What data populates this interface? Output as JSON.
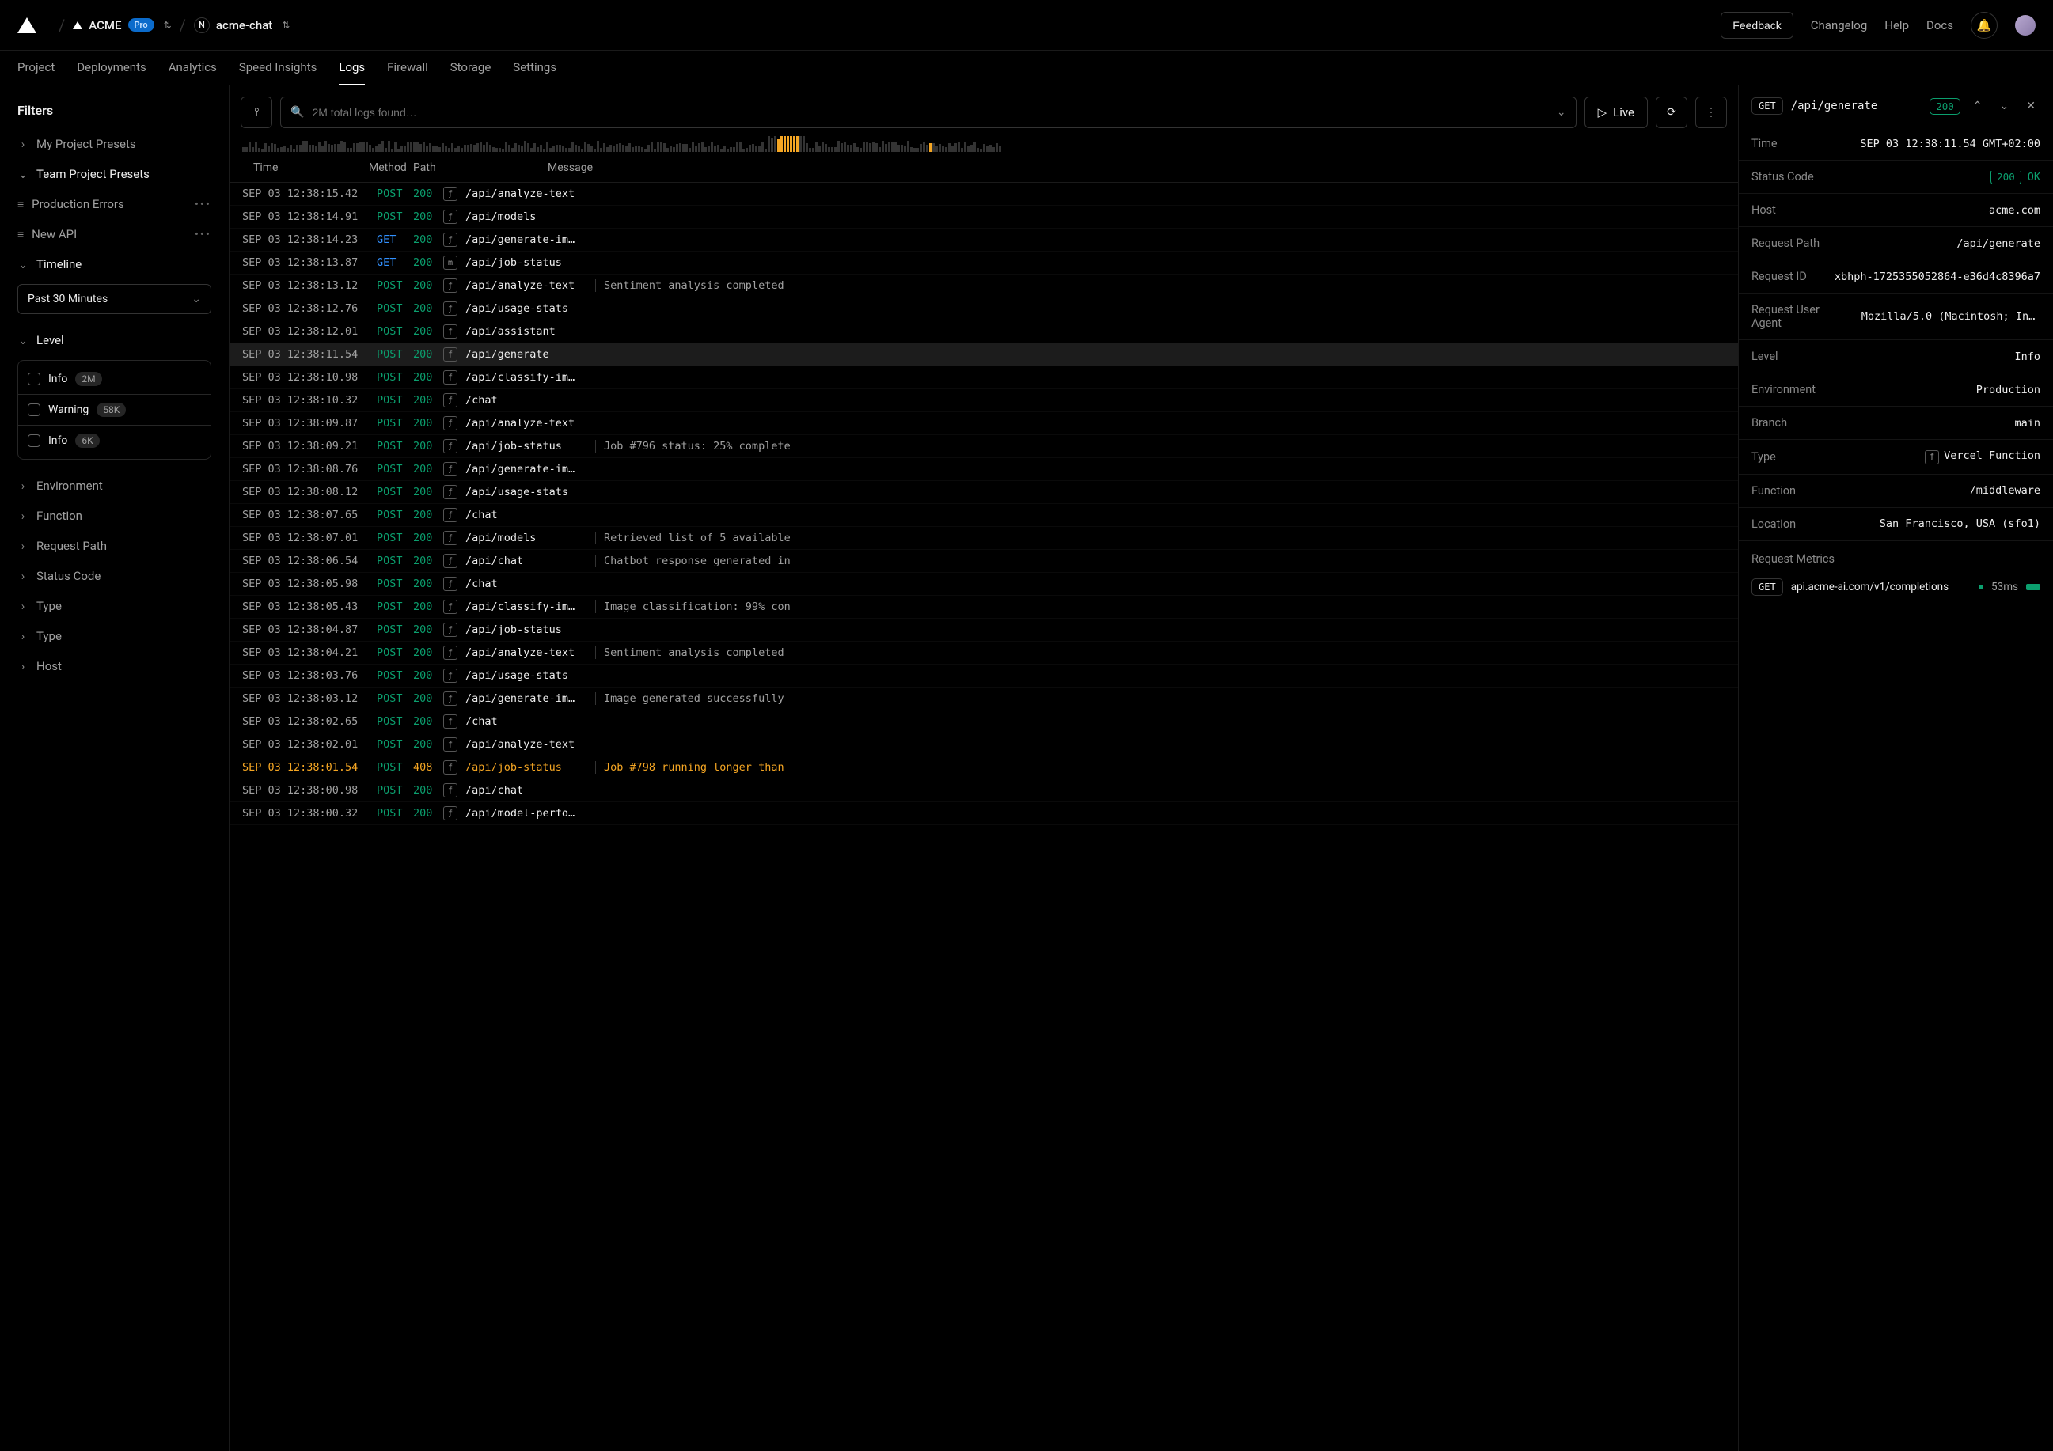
{
  "topbar": {
    "team": "ACME",
    "badge": "Pro",
    "project": "acme-chat",
    "feedback": "Feedback",
    "links": [
      "Changelog",
      "Help",
      "Docs"
    ]
  },
  "tabs": [
    "Project",
    "Deployments",
    "Analytics",
    "Speed Insights",
    "Logs",
    "Firewall",
    "Storage",
    "Settings"
  ],
  "active_tab": "Logs",
  "sidebar": {
    "title": "Filters",
    "my_presets": "My Project Presets",
    "team_presets": "Team Project Presets",
    "presets": [
      {
        "name": "Production Errors"
      },
      {
        "name": "New API"
      }
    ],
    "timeline_label": "Timeline",
    "timeline_value": "Past 30 Minutes",
    "level_label": "Level",
    "levels": [
      {
        "name": "Info",
        "count": "2M"
      },
      {
        "name": "Warning",
        "count": "58K"
      },
      {
        "name": "Info",
        "count": "6K"
      }
    ],
    "filters": [
      "Environment",
      "Function",
      "Request Path",
      "Status Code",
      "Type",
      "Type",
      "Host"
    ]
  },
  "toolbar": {
    "search_placeholder": "2M total logs found…",
    "live": "Live"
  },
  "columns": {
    "time": "Time",
    "method": "Method",
    "path": "Path",
    "message": "Message"
  },
  "logs": [
    {
      "ts": "SEP 03 12:38:15.42",
      "m": "POST",
      "s": "200",
      "icon": "fn",
      "p": "/api/analyze-text",
      "msg": ""
    },
    {
      "ts": "SEP 03 12:38:14.91",
      "m": "POST",
      "s": "200",
      "icon": "fn",
      "p": "/api/models",
      "msg": ""
    },
    {
      "ts": "SEP 03 12:38:14.23",
      "m": "GET",
      "s": "200",
      "icon": "fn",
      "p": "/api/generate-im…",
      "msg": ""
    },
    {
      "ts": "SEP 03 12:38:13.87",
      "m": "GET",
      "s": "200",
      "icon": "m",
      "p": "/api/job-status",
      "msg": ""
    },
    {
      "ts": "SEP 03 12:38:13.12",
      "m": "POST",
      "s": "200",
      "icon": "fn",
      "p": "/api/analyze-text",
      "msg": "Sentiment analysis completed"
    },
    {
      "ts": "SEP 03 12:38:12.76",
      "m": "POST",
      "s": "200",
      "icon": "fn",
      "p": "/api/usage-stats",
      "msg": ""
    },
    {
      "ts": "SEP 03 12:38:12.01",
      "m": "POST",
      "s": "200",
      "icon": "fn",
      "p": "/api/assistant",
      "msg": ""
    },
    {
      "ts": "SEP 03 12:38:11.54",
      "m": "POST",
      "s": "200",
      "icon": "fn",
      "p": "/api/generate",
      "msg": "",
      "selected": true
    },
    {
      "ts": "SEP 03 12:38:10.98",
      "m": "POST",
      "s": "200",
      "icon": "fn",
      "p": "/api/classify-im…",
      "msg": ""
    },
    {
      "ts": "SEP 03 12:38:10.32",
      "m": "POST",
      "s": "200",
      "icon": "fn",
      "p": "/chat",
      "msg": ""
    },
    {
      "ts": "SEP 03 12:38:09.87",
      "m": "POST",
      "s": "200",
      "icon": "fn",
      "p": "/api/analyze-text",
      "msg": ""
    },
    {
      "ts": "SEP 03 12:38:09.21",
      "m": "POST",
      "s": "200",
      "icon": "fn",
      "p": "/api/job-status",
      "msg": "Job #796 status: 25% complete"
    },
    {
      "ts": "SEP 03 12:38:08.76",
      "m": "POST",
      "s": "200",
      "icon": "fn",
      "p": "/api/generate-im…",
      "msg": ""
    },
    {
      "ts": "SEP 03 12:38:08.12",
      "m": "POST",
      "s": "200",
      "icon": "fn",
      "p": "/api/usage-stats",
      "msg": ""
    },
    {
      "ts": "SEP 03 12:38:07.65",
      "m": "POST",
      "s": "200",
      "icon": "fn",
      "p": "/chat",
      "msg": ""
    },
    {
      "ts": "SEP 03 12:38:07.01",
      "m": "POST",
      "s": "200",
      "icon": "fn",
      "p": "/api/models",
      "msg": "Retrieved list of 5 available"
    },
    {
      "ts": "SEP 03 12:38:06.54",
      "m": "POST",
      "s": "200",
      "icon": "fn",
      "p": "/api/chat",
      "msg": "Chatbot response generated in"
    },
    {
      "ts": "SEP 03 12:38:05.98",
      "m": "POST",
      "s": "200",
      "icon": "fn",
      "p": "/chat",
      "msg": ""
    },
    {
      "ts": "SEP 03 12:38:05.43",
      "m": "POST",
      "s": "200",
      "icon": "fn",
      "p": "/api/classify-im…",
      "msg": "Image classification: 99% con"
    },
    {
      "ts": "SEP 03 12:38:04.87",
      "m": "POST",
      "s": "200",
      "icon": "fn",
      "p": "/api/job-status",
      "msg": ""
    },
    {
      "ts": "SEP 03 12:38:04.21",
      "m": "POST",
      "s": "200",
      "icon": "fn",
      "p": "/api/analyze-text",
      "msg": "Sentiment analysis completed"
    },
    {
      "ts": "SEP 03 12:38:03.76",
      "m": "POST",
      "s": "200",
      "icon": "fn",
      "p": "/api/usage-stats",
      "msg": ""
    },
    {
      "ts": "SEP 03 12:38:03.12",
      "m": "POST",
      "s": "200",
      "icon": "fn",
      "p": "/api/generate-im…",
      "msg": "Image generated successfully"
    },
    {
      "ts": "SEP 03 12:38:02.65",
      "m": "POST",
      "s": "200",
      "icon": "fn",
      "p": "/chat",
      "msg": ""
    },
    {
      "ts": "SEP 03 12:38:02.01",
      "m": "POST",
      "s": "200",
      "icon": "fn",
      "p": "/api/analyze-text",
      "msg": ""
    },
    {
      "ts": "SEP 03 12:38:01.54",
      "m": "POST",
      "s": "408",
      "icon": "fn",
      "p": "/api/job-status",
      "msg": "Job #798 running longer than",
      "warn": true
    },
    {
      "ts": "SEP 03 12:38:00.98",
      "m": "POST",
      "s": "200",
      "icon": "fn",
      "p": "/api/chat",
      "msg": ""
    },
    {
      "ts": "SEP 03 12:38:00.32",
      "m": "POST",
      "s": "200",
      "icon": "fn",
      "p": "/api/model-perfo…",
      "msg": ""
    }
  ],
  "detail": {
    "method": "GET",
    "path": "/api/generate",
    "status": "200",
    "kv": [
      {
        "k": "Time",
        "v": "SEP 03 12:38:11.54 GMT+02:00"
      },
      {
        "k": "Status Code",
        "v": "200",
        "ok": "OK",
        "badge": true
      },
      {
        "k": "Host",
        "v": "acme.com"
      },
      {
        "k": "Request Path",
        "v": "/api/generate"
      },
      {
        "k": "Request ID",
        "v": "xbhph-1725355052864-e36d4c8396a7"
      },
      {
        "k": "Request User Agent",
        "v": "Mozilla/5.0 (Macintosh; Int…"
      },
      {
        "k": "Level",
        "v": "Info"
      },
      {
        "k": "Environment",
        "v": "Production"
      },
      {
        "k": "Branch",
        "v": "main"
      },
      {
        "k": "Type",
        "v": "Vercel Function",
        "icon": "fn"
      },
      {
        "k": "Function",
        "v": "/middleware"
      },
      {
        "k": "Location",
        "v": "San Francisco, USA (sfo1)"
      }
    ],
    "metrics_label": "Request Metrics",
    "metric": {
      "method": "GET",
      "host": "api.acme-ai.com/v1/completions",
      "time": "53ms"
    }
  }
}
